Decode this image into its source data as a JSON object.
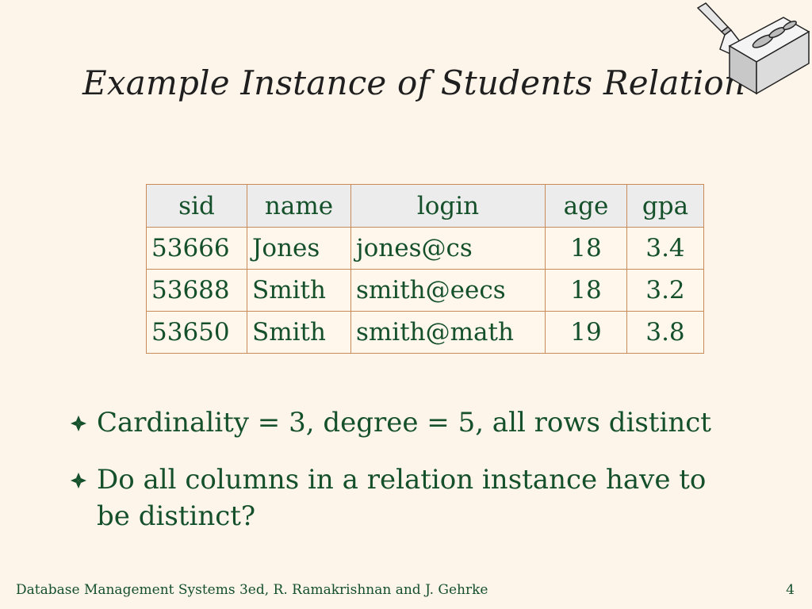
{
  "slide": {
    "title": "Example Instance of Students Relation",
    "logo_icon": "brick-trowel-icon"
  },
  "table": {
    "headers": [
      "sid",
      "name",
      "login",
      "age",
      "gpa"
    ],
    "rows": [
      [
        "53666",
        "Jones",
        "jones@cs",
        "18",
        "3.4"
      ],
      [
        "53688",
        "Smith",
        "smith@eecs",
        "18",
        "3.2"
      ],
      [
        "53650",
        "Smith",
        "smith@math",
        "19",
        "3.8"
      ]
    ]
  },
  "bullets": [
    "Cardinality = 3, degree = 5, all rows distinct",
    "Do all columns in a relation instance have to be distinct?"
  ],
  "bullet_icon": "diamond-bullet-icon",
  "footer": {
    "text": "Database Management Systems 3ed,  R. Ramakrishnan and J. Gehrke",
    "page_number": "4"
  },
  "colors": {
    "background": "#fdf4ea",
    "text_green": "#14502a",
    "table_border": "#c98a5a",
    "header_fill": "#ececec"
  }
}
